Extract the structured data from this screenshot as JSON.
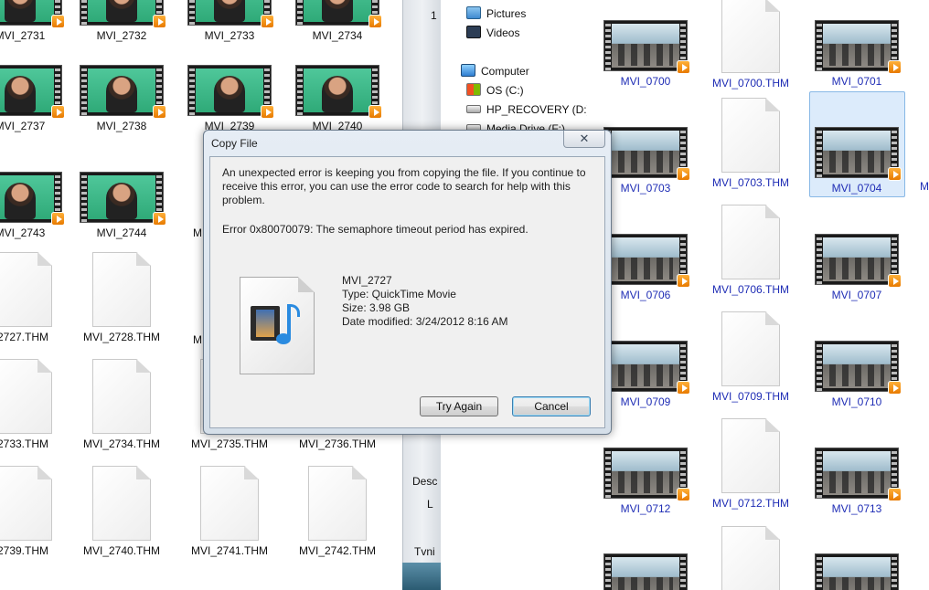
{
  "left_pane": {
    "rows": [
      [
        "MVI_2731",
        "MVI_2732",
        "MVI_2733",
        "MVI_2734"
      ],
      [
        "MVI_2737",
        "MVI_2738",
        "MVI_2739",
        "MVI_2740"
      ],
      [
        "MVI_2743",
        "MVI_2744",
        "M"
      ],
      [
        "2727.THM",
        "MVI_2728.THM",
        "M"
      ],
      [
        "2733.THM",
        "MVI_2734.THM",
        "MVI_2735.THM",
        "MVI_2736.THM"
      ],
      [
        "2739.THM",
        "MVI_2740.THM",
        "MVI_2741.THM",
        "MVI_2742.THM"
      ]
    ]
  },
  "middle_strip": {
    "top_digit": "1",
    "labels": [
      "Desc",
      "L",
      "Tvni"
    ]
  },
  "nav_pane": {
    "items": [
      {
        "label": "Pictures",
        "icon": "pictures-icon"
      },
      {
        "label": "Videos",
        "icon": "videos-icon"
      },
      {
        "label": "Computer",
        "icon": "computer-icon"
      },
      {
        "label": "OS (C:)",
        "icon": "os-drive-icon"
      },
      {
        "label": "HP_RECOVERY (D:)",
        "icon": "drive-icon"
      },
      {
        "label": "Media Drive (F:)",
        "icon": "drive-icon"
      }
    ]
  },
  "right_pane": {
    "rows": [
      [
        "MVI_0700",
        "MVI_0700.THM",
        "MVI_0701"
      ],
      [
        "MVI_0703",
        "MVI_0703.THM",
        "MVI_0704"
      ],
      [
        "MVI_0706",
        "MVI_0706.THM",
        "MVI_0707"
      ],
      [
        "MVI_0709",
        "MVI_0709.THM",
        "MVI_0710"
      ],
      [
        "MVI_0712",
        "MVI_0712.THM",
        "MVI_0713"
      ]
    ],
    "selected": "MVI_0704",
    "edge_letter": "M"
  },
  "dialog": {
    "title": "Copy File",
    "close_glyph": "✕",
    "message": "An unexpected error is keeping you from copying the file. If you continue to receive this error, you can use the error code to search for help with this problem.",
    "error": "Error 0x80070079: The semaphore timeout period has expired.",
    "file": {
      "name": "MVI_2727",
      "type": "Type: QuickTime Movie",
      "size": "Size: 3.98 GB",
      "modified": "Date modified: 3/24/2012 8:16 AM"
    },
    "buttons": {
      "try_again": "Try Again",
      "cancel": "Cancel"
    }
  },
  "colors": {
    "link_blue": "#1f2db5",
    "selection": "#dcebfb",
    "dialog_frame": "#d5dfe9"
  }
}
